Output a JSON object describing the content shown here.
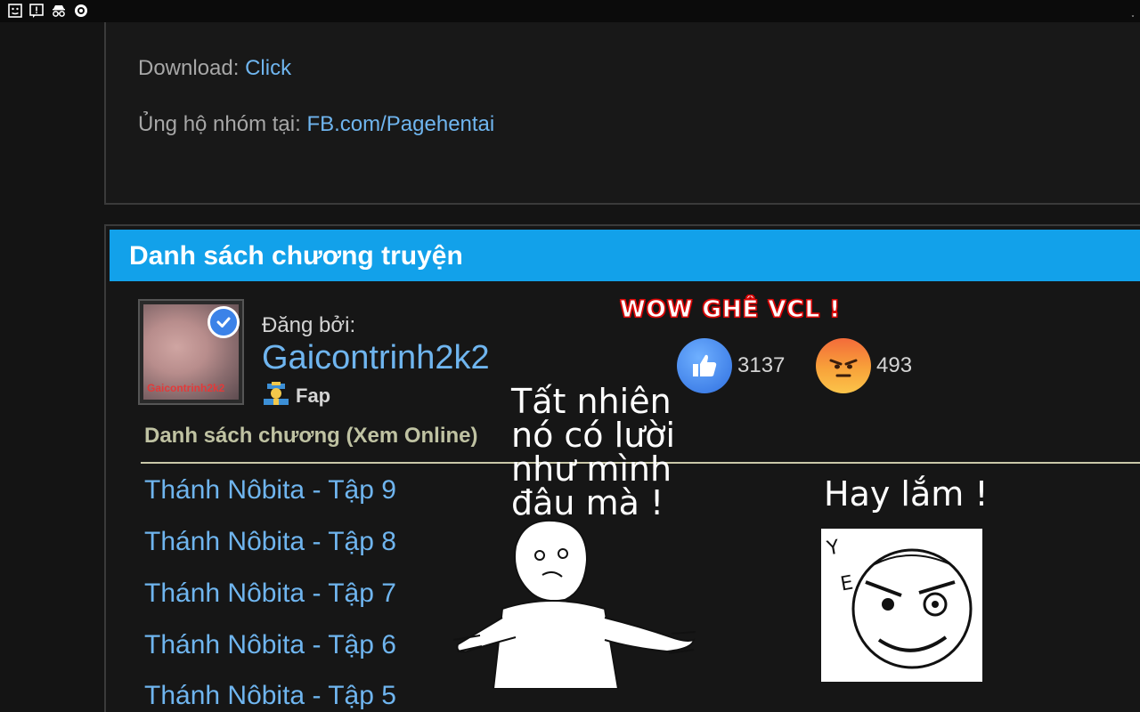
{
  "topbar": {
    "icons": [
      "face-icon",
      "alert-icon",
      "spy-icon",
      "settings-icon"
    ],
    "chevron": "˯"
  },
  "info": {
    "download_label": "Download:",
    "download_link": "Click",
    "support_label": "Ủng hộ nhóm tại:",
    "support_link": "FB.com/Pagehentai"
  },
  "section": {
    "title": "Danh sách chương truyện"
  },
  "poster": {
    "label": "Đăng bởi:",
    "name": "Gaicontrinh2k2",
    "rank": "Fap",
    "avatar_watermark": "Gaicontrinh2k2"
  },
  "reactions": {
    "banner": "WOW GHÊ VCL !",
    "like_count": "3137",
    "angry_count": "493"
  },
  "chapters": {
    "heading": "Danh sách chương (Xem Online)",
    "items": [
      "Thánh Nôbita - Tập 9",
      "Thánh Nôbita - Tập 8",
      "Thánh Nôbita - Tập 7",
      "Thánh Nôbita - Tập 6",
      "Thánh Nôbita - Tập 5"
    ]
  },
  "memes": {
    "caption1": "Tất nhiên nó có lười như mình đâu mà !",
    "caption2": "Hay lắm !",
    "yes_letters": "YES"
  },
  "colors": {
    "accent": "#12a1ea",
    "link": "#6fb5ef",
    "background": "#141414"
  }
}
